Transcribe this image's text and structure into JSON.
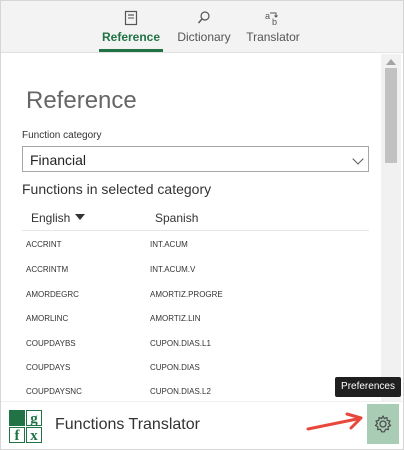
{
  "tabs": [
    {
      "label": "Reference",
      "icon": "book-icon",
      "active": true
    },
    {
      "label": "Dictionary",
      "icon": "search-icon",
      "active": false
    },
    {
      "label": "Translator",
      "icon": "translate-icon",
      "active": false
    }
  ],
  "main": {
    "title": "Reference",
    "category_label": "Function category",
    "category_value": "Financial",
    "section_title": "Functions in selected category",
    "columns": {
      "english": "English",
      "spanish": "Spanish"
    },
    "rows": [
      {
        "en": "ACCRINT",
        "es": "INT.ACUM"
      },
      {
        "en": "ACCRINTM",
        "es": "INT.ACUM.V"
      },
      {
        "en": "AMORDEGRC",
        "es": "AMORTIZ.PROGRE"
      },
      {
        "en": "AMORLINC",
        "es": "AMORTIZ.LIN"
      },
      {
        "en": "COUPDAYBS",
        "es": "CUPON.DIAS.L1"
      },
      {
        "en": "COUPDAYS",
        "es": "CUPON.DIAS"
      },
      {
        "en": "COUPDAYSNC",
        "es": "CUPON.DIAS.L2"
      }
    ]
  },
  "footer": {
    "app_title": "Functions Translator",
    "logo_letters": [
      "f",
      "g",
      "x"
    ],
    "preferences_tooltip": "Preferences"
  },
  "colors": {
    "accent": "#217346",
    "logo_green": "#217346",
    "settings_bg": "#a8cdb4",
    "annotation_arrow": "#e8483b"
  }
}
